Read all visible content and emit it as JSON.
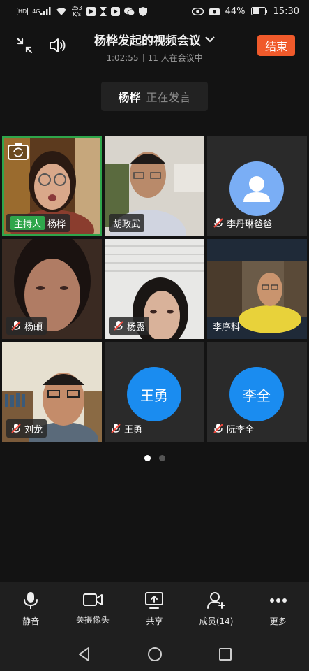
{
  "status_bar": {
    "hd": "HD",
    "network": "4G",
    "speed_value": "253",
    "speed_unit": "K/s",
    "battery": "44%",
    "time": "15:30"
  },
  "header": {
    "title": "杨桦发起的视频会议",
    "duration": "1:02:55",
    "participants_info": "11 人在会议中",
    "end_label": "结束"
  },
  "speaker": {
    "name": "杨桦",
    "status": "正在发言"
  },
  "tiles": [
    {
      "name": "杨桦",
      "host_label": "主持人",
      "muted": false,
      "kind": "video"
    },
    {
      "name": "胡政武",
      "muted": false,
      "kind": "video"
    },
    {
      "name": "李丹琳爸爸",
      "muted": true,
      "kind": "default-avatar"
    },
    {
      "name": "杨頔",
      "muted": true,
      "kind": "video"
    },
    {
      "name": "杨露",
      "muted": true,
      "kind": "video"
    },
    {
      "name": "李序科",
      "muted": false,
      "kind": "video"
    },
    {
      "name": "刘龙",
      "muted": true,
      "kind": "video"
    },
    {
      "name": "王勇",
      "avatar_text": "王勇",
      "muted": true,
      "kind": "text-avatar"
    },
    {
      "name": "阮李全",
      "avatar_text": "李全",
      "muted": true,
      "kind": "text-avatar"
    }
  ],
  "pagination": {
    "current": 1,
    "total": 2
  },
  "toolbar": {
    "mute": "静音",
    "camera": "关摄像头",
    "share": "共享",
    "members": "成员(14)",
    "more": "更多"
  },
  "colors": {
    "accent_green": "#2fa64b",
    "end_orange": "#f05a2b",
    "avatar_blue": "#1a8cf0"
  }
}
